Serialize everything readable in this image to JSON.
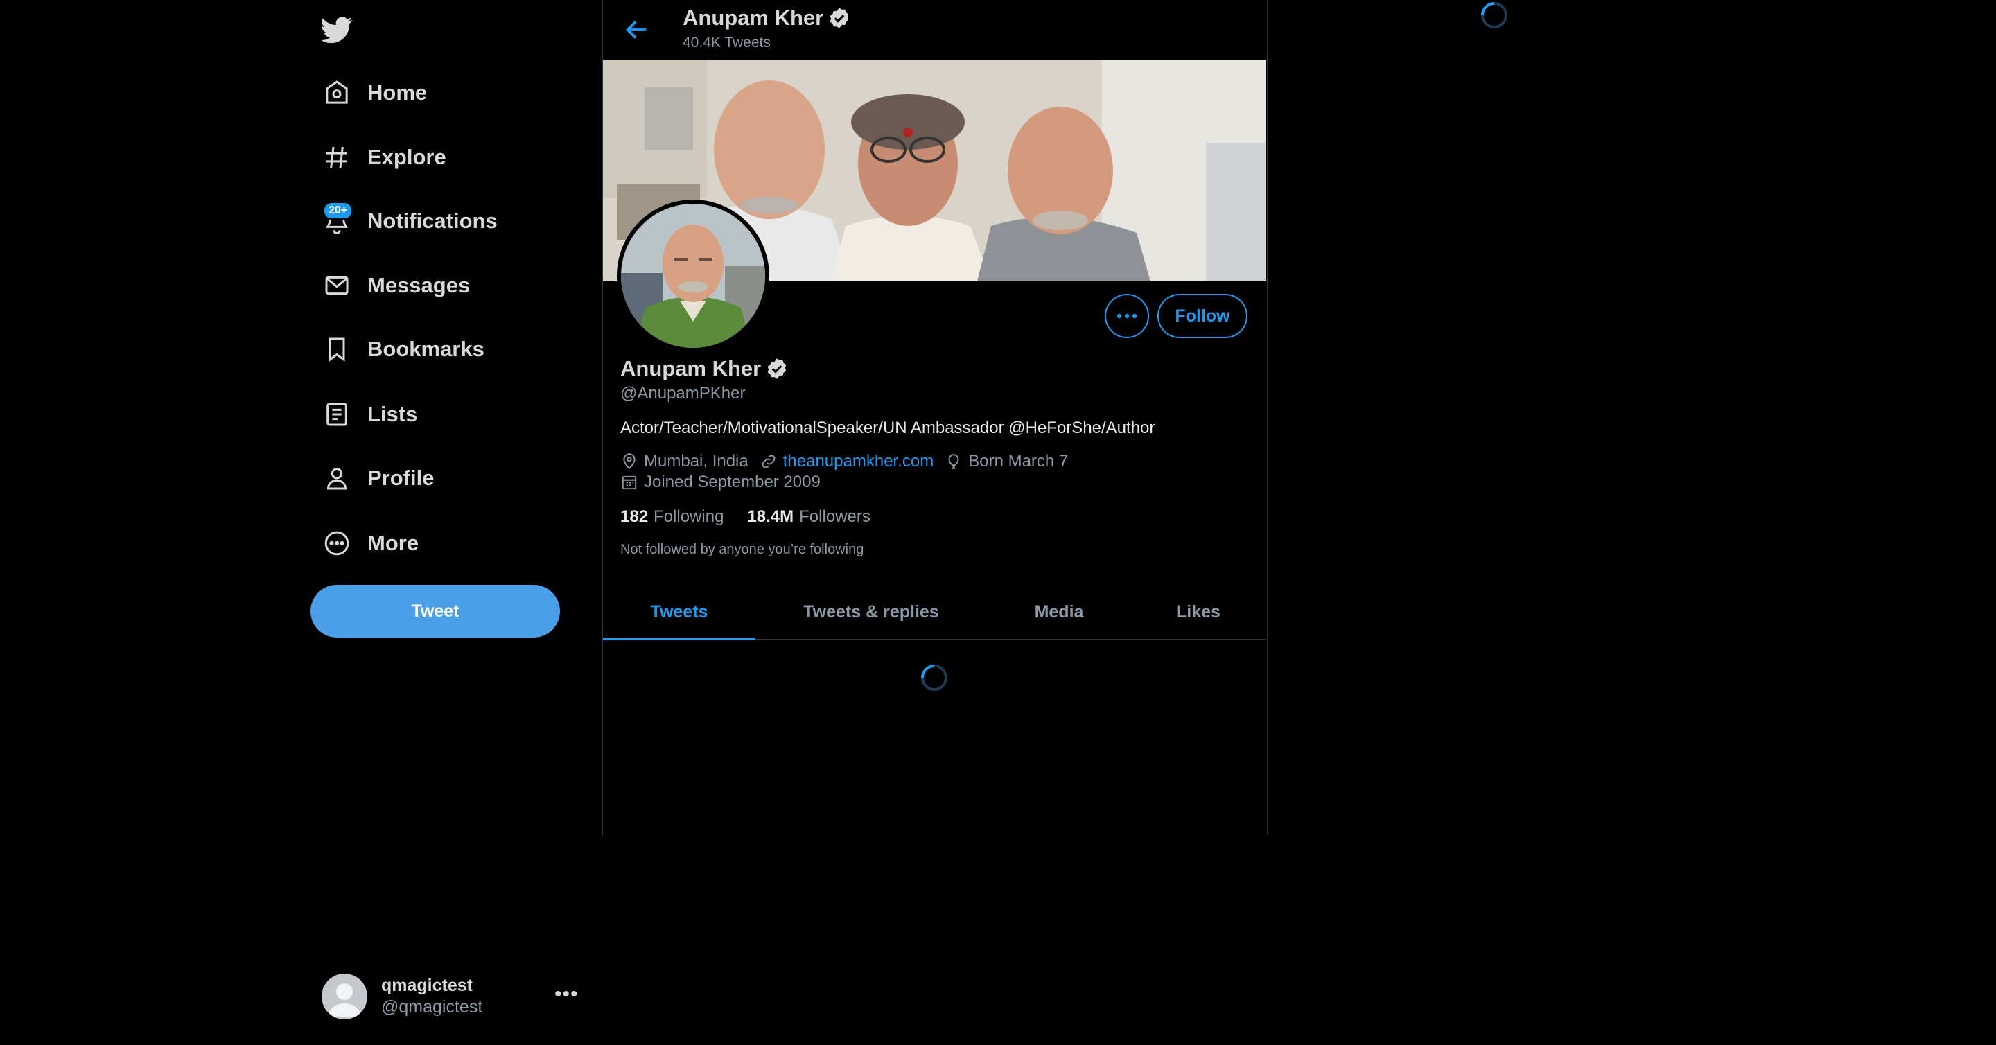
{
  "sidebar": {
    "items": [
      {
        "label": "Home",
        "icon": "home-icon"
      },
      {
        "label": "Explore",
        "icon": "hashtag-icon"
      },
      {
        "label": "Notifications",
        "icon": "bell-icon",
        "badge": "20+"
      },
      {
        "label": "Messages",
        "icon": "envelope-icon"
      },
      {
        "label": "Bookmarks",
        "icon": "bookmark-icon"
      },
      {
        "label": "Lists",
        "icon": "list-icon"
      },
      {
        "label": "Profile",
        "icon": "person-icon"
      },
      {
        "label": "More",
        "icon": "more-circle-icon"
      }
    ],
    "tweet_button": "Tweet"
  },
  "account": {
    "name": "qmagictest",
    "handle": "@qmagictest"
  },
  "header": {
    "name": "Anupam Kher",
    "tweet_count": "40.4K Tweets"
  },
  "profile": {
    "name": "Anupam Kher",
    "handle": "@AnupamPKher",
    "bio": "Actor/Teacher/MotivationalSpeaker/UN Ambassador @HeForShe/Author",
    "location": "Mumbai, India",
    "website": "theanupamkher.com",
    "birthday": "Born March 7",
    "joined": "Joined September 2009",
    "following_count": "182",
    "following_label": "Following",
    "followers_count": "18.4M",
    "followers_label": "Followers",
    "not_followed": "Not followed by anyone you’re following",
    "follow_button": "Follow"
  },
  "tabs": [
    {
      "label": "Tweets",
      "active": true
    },
    {
      "label": "Tweets & replies",
      "active": false
    },
    {
      "label": "Media",
      "active": false
    },
    {
      "label": "Likes",
      "active": false
    }
  ],
  "colors": {
    "accent": "#1d9bf0",
    "background": "#000000",
    "tweet_button": "#4a9fe8"
  }
}
